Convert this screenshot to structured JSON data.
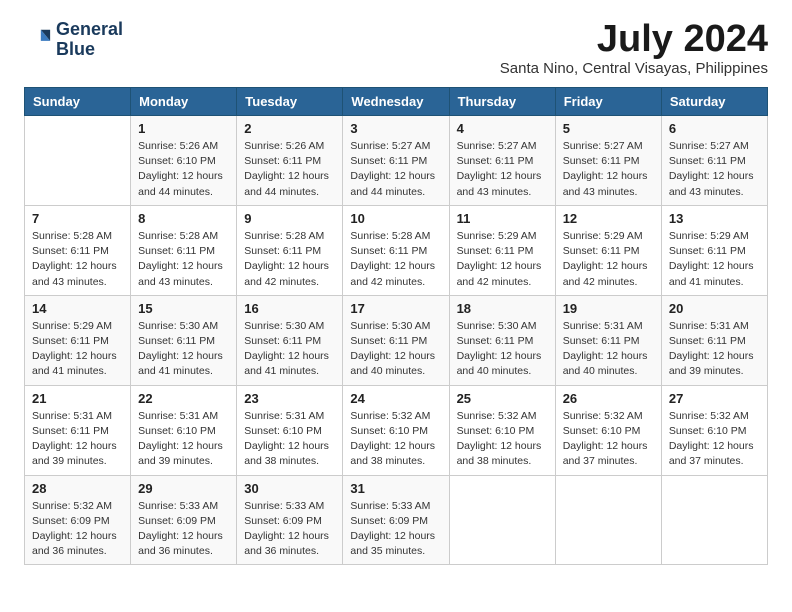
{
  "logo": {
    "line1": "General",
    "line2": "Blue"
  },
  "title": "July 2024",
  "subtitle": "Santa Nino, Central Visayas, Philippines",
  "header": {
    "days": [
      "Sunday",
      "Monday",
      "Tuesday",
      "Wednesday",
      "Thursday",
      "Friday",
      "Saturday"
    ]
  },
  "weeks": [
    [
      {
        "day": "",
        "sunrise": "",
        "sunset": "",
        "daylight": ""
      },
      {
        "day": "1",
        "sunrise": "Sunrise: 5:26 AM",
        "sunset": "Sunset: 6:10 PM",
        "daylight": "Daylight: 12 hours and 44 minutes."
      },
      {
        "day": "2",
        "sunrise": "Sunrise: 5:26 AM",
        "sunset": "Sunset: 6:11 PM",
        "daylight": "Daylight: 12 hours and 44 minutes."
      },
      {
        "day": "3",
        "sunrise": "Sunrise: 5:27 AM",
        "sunset": "Sunset: 6:11 PM",
        "daylight": "Daylight: 12 hours and 44 minutes."
      },
      {
        "day": "4",
        "sunrise": "Sunrise: 5:27 AM",
        "sunset": "Sunset: 6:11 PM",
        "daylight": "Daylight: 12 hours and 43 minutes."
      },
      {
        "day": "5",
        "sunrise": "Sunrise: 5:27 AM",
        "sunset": "Sunset: 6:11 PM",
        "daylight": "Daylight: 12 hours and 43 minutes."
      },
      {
        "day": "6",
        "sunrise": "Sunrise: 5:27 AM",
        "sunset": "Sunset: 6:11 PM",
        "daylight": "Daylight: 12 hours and 43 minutes."
      }
    ],
    [
      {
        "day": "7",
        "sunrise": "Sunrise: 5:28 AM",
        "sunset": "Sunset: 6:11 PM",
        "daylight": "Daylight: 12 hours and 43 minutes."
      },
      {
        "day": "8",
        "sunrise": "Sunrise: 5:28 AM",
        "sunset": "Sunset: 6:11 PM",
        "daylight": "Daylight: 12 hours and 43 minutes."
      },
      {
        "day": "9",
        "sunrise": "Sunrise: 5:28 AM",
        "sunset": "Sunset: 6:11 PM",
        "daylight": "Daylight: 12 hours and 42 minutes."
      },
      {
        "day": "10",
        "sunrise": "Sunrise: 5:28 AM",
        "sunset": "Sunset: 6:11 PM",
        "daylight": "Daylight: 12 hours and 42 minutes."
      },
      {
        "day": "11",
        "sunrise": "Sunrise: 5:29 AM",
        "sunset": "Sunset: 6:11 PM",
        "daylight": "Daylight: 12 hours and 42 minutes."
      },
      {
        "day": "12",
        "sunrise": "Sunrise: 5:29 AM",
        "sunset": "Sunset: 6:11 PM",
        "daylight": "Daylight: 12 hours and 42 minutes."
      },
      {
        "day": "13",
        "sunrise": "Sunrise: 5:29 AM",
        "sunset": "Sunset: 6:11 PM",
        "daylight": "Daylight: 12 hours and 41 minutes."
      }
    ],
    [
      {
        "day": "14",
        "sunrise": "Sunrise: 5:29 AM",
        "sunset": "Sunset: 6:11 PM",
        "daylight": "Daylight: 12 hours and 41 minutes."
      },
      {
        "day": "15",
        "sunrise": "Sunrise: 5:30 AM",
        "sunset": "Sunset: 6:11 PM",
        "daylight": "Daylight: 12 hours and 41 minutes."
      },
      {
        "day": "16",
        "sunrise": "Sunrise: 5:30 AM",
        "sunset": "Sunset: 6:11 PM",
        "daylight": "Daylight: 12 hours and 41 minutes."
      },
      {
        "day": "17",
        "sunrise": "Sunrise: 5:30 AM",
        "sunset": "Sunset: 6:11 PM",
        "daylight": "Daylight: 12 hours and 40 minutes."
      },
      {
        "day": "18",
        "sunrise": "Sunrise: 5:30 AM",
        "sunset": "Sunset: 6:11 PM",
        "daylight": "Daylight: 12 hours and 40 minutes."
      },
      {
        "day": "19",
        "sunrise": "Sunrise: 5:31 AM",
        "sunset": "Sunset: 6:11 PM",
        "daylight": "Daylight: 12 hours and 40 minutes."
      },
      {
        "day": "20",
        "sunrise": "Sunrise: 5:31 AM",
        "sunset": "Sunset: 6:11 PM",
        "daylight": "Daylight: 12 hours and 39 minutes."
      }
    ],
    [
      {
        "day": "21",
        "sunrise": "Sunrise: 5:31 AM",
        "sunset": "Sunset: 6:11 PM",
        "daylight": "Daylight: 12 hours and 39 minutes."
      },
      {
        "day": "22",
        "sunrise": "Sunrise: 5:31 AM",
        "sunset": "Sunset: 6:10 PM",
        "daylight": "Daylight: 12 hours and 39 minutes."
      },
      {
        "day": "23",
        "sunrise": "Sunrise: 5:31 AM",
        "sunset": "Sunset: 6:10 PM",
        "daylight": "Daylight: 12 hours and 38 minutes."
      },
      {
        "day": "24",
        "sunrise": "Sunrise: 5:32 AM",
        "sunset": "Sunset: 6:10 PM",
        "daylight": "Daylight: 12 hours and 38 minutes."
      },
      {
        "day": "25",
        "sunrise": "Sunrise: 5:32 AM",
        "sunset": "Sunset: 6:10 PM",
        "daylight": "Daylight: 12 hours and 38 minutes."
      },
      {
        "day": "26",
        "sunrise": "Sunrise: 5:32 AM",
        "sunset": "Sunset: 6:10 PM",
        "daylight": "Daylight: 12 hours and 37 minutes."
      },
      {
        "day": "27",
        "sunrise": "Sunrise: 5:32 AM",
        "sunset": "Sunset: 6:10 PM",
        "daylight": "Daylight: 12 hours and 37 minutes."
      }
    ],
    [
      {
        "day": "28",
        "sunrise": "Sunrise: 5:32 AM",
        "sunset": "Sunset: 6:09 PM",
        "daylight": "Daylight: 12 hours and 36 minutes."
      },
      {
        "day": "29",
        "sunrise": "Sunrise: 5:33 AM",
        "sunset": "Sunset: 6:09 PM",
        "daylight": "Daylight: 12 hours and 36 minutes."
      },
      {
        "day": "30",
        "sunrise": "Sunrise: 5:33 AM",
        "sunset": "Sunset: 6:09 PM",
        "daylight": "Daylight: 12 hours and 36 minutes."
      },
      {
        "day": "31",
        "sunrise": "Sunrise: 5:33 AM",
        "sunset": "Sunset: 6:09 PM",
        "daylight": "Daylight: 12 hours and 35 minutes."
      },
      {
        "day": "",
        "sunrise": "",
        "sunset": "",
        "daylight": ""
      },
      {
        "day": "",
        "sunrise": "",
        "sunset": "",
        "daylight": ""
      },
      {
        "day": "",
        "sunrise": "",
        "sunset": "",
        "daylight": ""
      }
    ]
  ]
}
